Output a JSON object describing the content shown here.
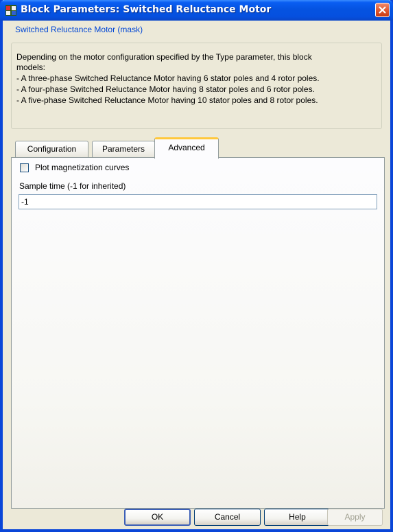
{
  "window": {
    "title": "Block Parameters: Switched Reluctance Motor"
  },
  "mask": {
    "legend": "Switched Reluctance Motor (mask)",
    "description": [
      "Depending on the motor configuration specified by the Type parameter,  this block",
      "models:",
      "- A three-phase Switched Reluctance Motor having 6   stator poles and 4 rotor poles.",
      "- A four-phase   Switched Reluctance Motor having 8   stator poles and 6 rotor poles.",
      "- A five-phase   Switched Reluctance Motor having 10 stator poles and 8 rotor poles."
    ]
  },
  "tabs": [
    {
      "label": "Configuration"
    },
    {
      "label": "Parameters"
    },
    {
      "label": "Advanced",
      "active": true
    }
  ],
  "advanced": {
    "plot_magnetization": {
      "label": "Plot magnetization curves",
      "checked": false
    },
    "sample_time": {
      "label": "Sample time (-1 for inherited)",
      "value": "-1"
    }
  },
  "buttons": {
    "ok": "OK",
    "cancel": "Cancel",
    "help": "Help",
    "apply": "Apply"
  },
  "icons": {
    "app": "simulink-block-icon",
    "close": "close-icon"
  },
  "colors": {
    "titlebar": "#0553e1",
    "legend_text": "#0046d5",
    "active_tab_highlight": "#ffc83c"
  }
}
